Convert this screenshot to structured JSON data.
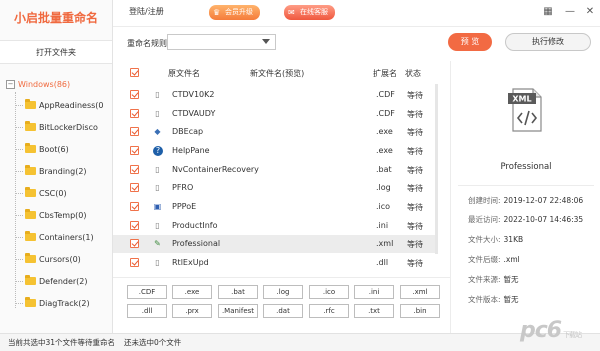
{
  "app": {
    "logo": "小启批量重命名",
    "open_folder": "打开文件夹"
  },
  "topbar": {
    "login": "登陆/注册",
    "promo1": "会员升级",
    "promo2": "在线客服",
    "grid_icon": "grid-icon",
    "min_icon": "minimize-icon",
    "close_icon": "close-icon"
  },
  "rule": {
    "label": "重命名规则",
    "value": ""
  },
  "buttons": {
    "preview": "预 览",
    "execute": "执行修改"
  },
  "tree": {
    "root": "Windows(86)",
    "items": [
      "AppReadiness(0",
      "BitLockerDisco",
      "Boot(6)",
      "Branding(2)",
      "CSC(0)",
      "CbsTemp(0)",
      "Containers(1)",
      "Cursors(0)",
      "Defender(2)",
      "DiagTrack(2)"
    ]
  },
  "table": {
    "headers": {
      "original": "原文件名",
      "new": "新文件名(预览)",
      "ext": "扩展名",
      "status": "状态"
    },
    "rows": [
      {
        "name": "CTDV10K2",
        "ext": ".CDF",
        "status": "等待",
        "icon": "document-icon",
        "selected": false
      },
      {
        "name": "CTDVAUDY",
        "ext": ".CDF",
        "status": "等待",
        "icon": "document-icon",
        "selected": false
      },
      {
        "name": "DBEcap",
        "ext": ".exe",
        "status": "等待",
        "icon": "exe-icon",
        "selected": false
      },
      {
        "name": "HelpPane",
        "ext": ".exe",
        "status": "等待",
        "icon": "help-icon",
        "selected": false
      },
      {
        "name": "NvContainerRecovery",
        "ext": ".bat",
        "status": "等待",
        "icon": "batch-icon",
        "selected": false
      },
      {
        "name": "PFRO",
        "ext": ".log",
        "status": "等待",
        "icon": "document-icon",
        "selected": false
      },
      {
        "name": "PPPoE",
        "ext": ".ico",
        "status": "等待",
        "icon": "image-icon",
        "selected": false
      },
      {
        "name": "ProductInfo",
        "ext": ".ini",
        "status": "等待",
        "icon": "document-icon",
        "selected": false
      },
      {
        "name": "Professional",
        "ext": ".xml",
        "status": "等待",
        "icon": "xml-icon",
        "selected": true
      },
      {
        "name": "RtlExUpd",
        "ext": ".dll",
        "status": "等待",
        "icon": "dll-icon",
        "selected": false
      }
    ]
  },
  "ext_buttons": [
    ".CDF",
    ".exe",
    ".bat",
    ".log",
    ".ico",
    ".ini",
    ".xml",
    ".dll",
    ".prx",
    ".Manifest",
    ".dat",
    ".rfc",
    ".txt",
    ".bin"
  ],
  "preview": {
    "icon_label": "XML",
    "file_name": "Professional",
    "info": [
      {
        "k": "创建时间:",
        "v": "2019-12-07 22:48:06"
      },
      {
        "k": "最近访问:",
        "v": "2022-10-07 14:46:35"
      },
      {
        "k": "文件大小:",
        "v": "31KB"
      },
      {
        "k": "文件后缀:",
        "v": ".xml"
      },
      {
        "k": "文件来源:",
        "v": "暂无"
      },
      {
        "k": "文件版本:",
        "v": "暂无"
      }
    ]
  },
  "statusbar": {
    "left": "当前共选中31个文件等待重命名",
    "right": "还未选中0个文件"
  },
  "watermark": {
    "logo": "pc6",
    "sub": "下载站"
  },
  "colors": {
    "accent": "#f26a43",
    "tree_root": "#f06a3e",
    "folder": "#f5c232"
  }
}
